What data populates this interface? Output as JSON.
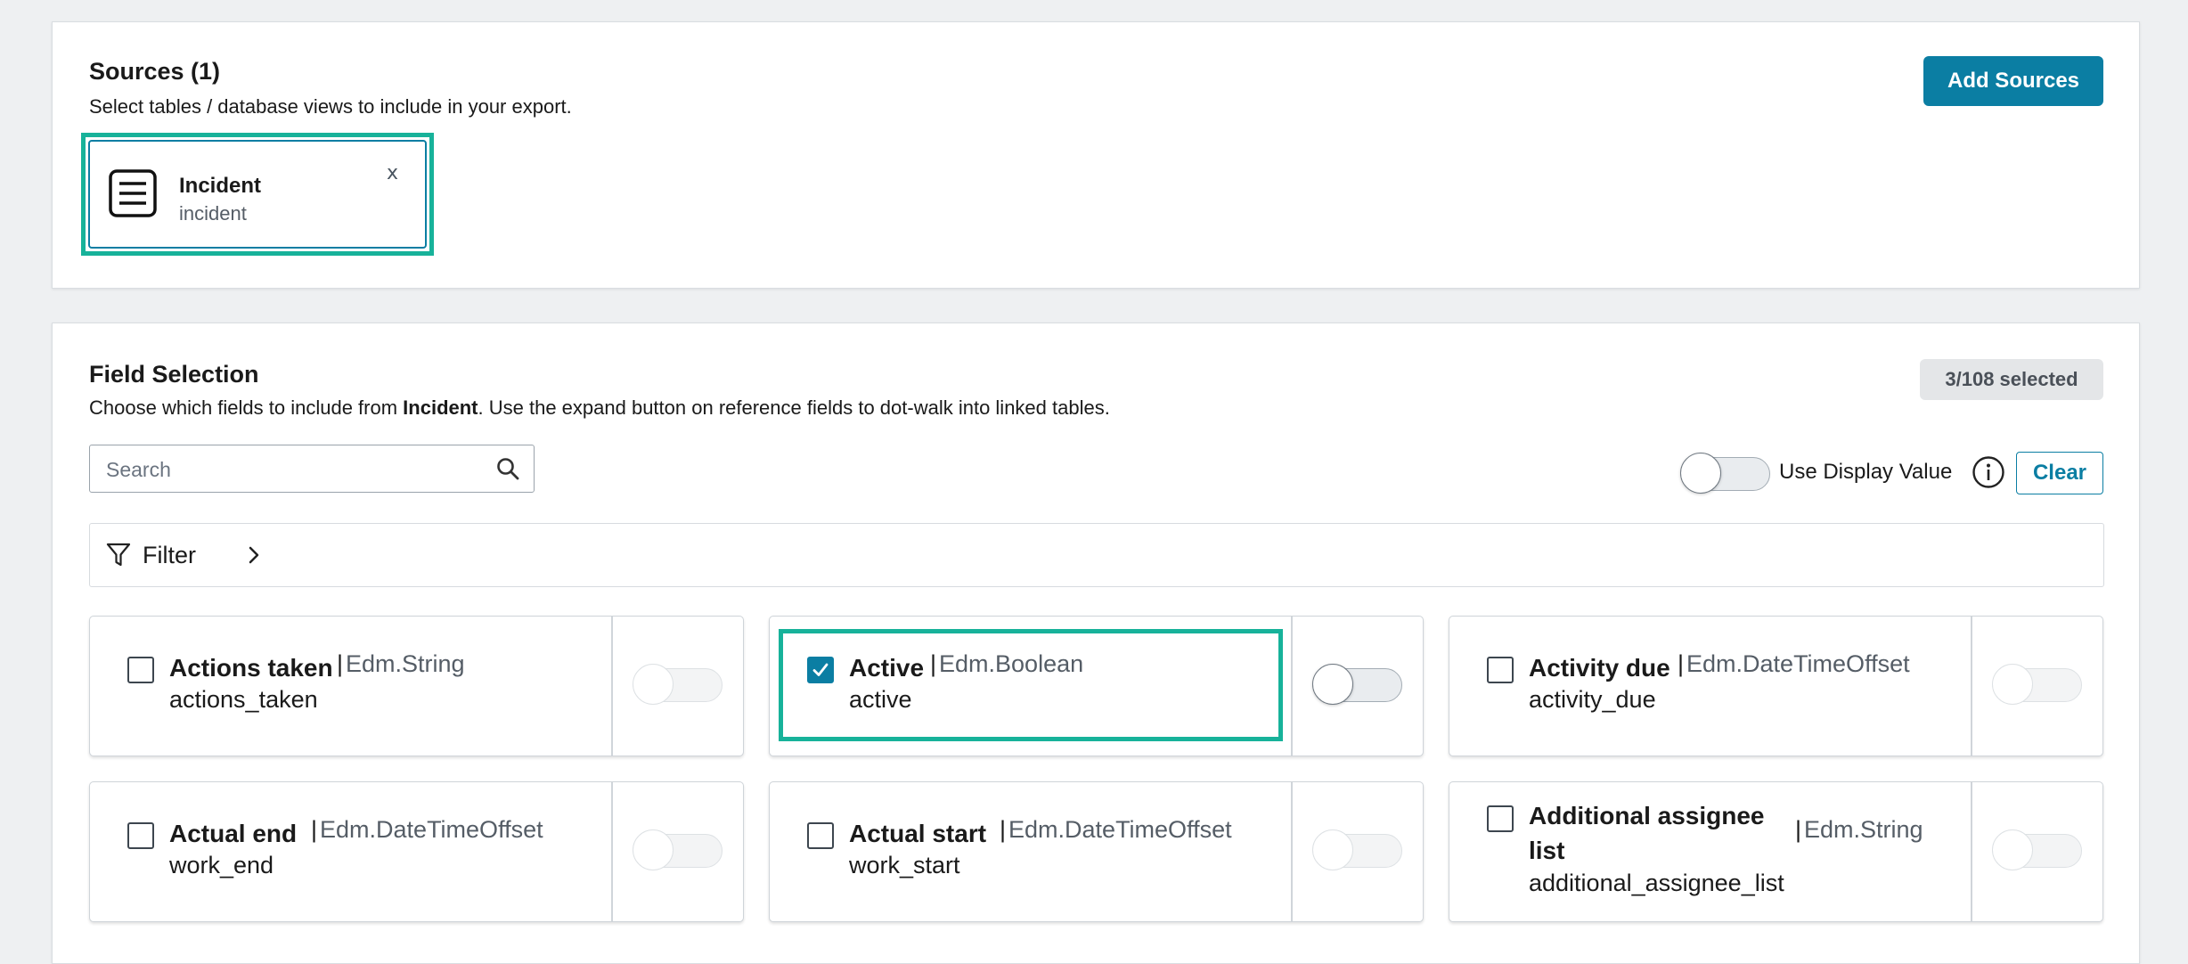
{
  "sources": {
    "title": "Sources (1)",
    "description": "Select tables / database views to include in your export.",
    "add_button": "Add Sources",
    "items": [
      {
        "label": "Incident",
        "name": "incident",
        "remove": "x"
      }
    ]
  },
  "fields": {
    "title": "Field Selection",
    "description_pre": "Choose which fields to include from ",
    "description_table": "Incident",
    "description_post": ". Use the expand button on reference fields to dot-walk into linked tables.",
    "selected_badge": "3/108 selected",
    "search_placeholder": "Search",
    "use_display_value_label": "Use Display Value",
    "clear_button": "Clear",
    "filter_label": "Filter",
    "type_separator": "|",
    "items": [
      {
        "label": "Actions taken",
        "type": "Edm.String",
        "name": "actions_taken",
        "checked": false
      },
      {
        "label": "Active",
        "type": "Edm.Boolean",
        "name": "active",
        "checked": true
      },
      {
        "label": "Activity due",
        "type": "Edm.DateTimeOffset",
        "name": "activity_due",
        "checked": false
      },
      {
        "label": "Actual end",
        "type": "Edm.DateTimeOffset",
        "name": "work_end",
        "checked": false
      },
      {
        "label": "Actual start",
        "type": "Edm.DateTimeOffset",
        "name": "work_start",
        "checked": false
      },
      {
        "label": "Additional assignee list",
        "type": "Edm.String",
        "name": "additional_assignee_list",
        "checked": false
      }
    ]
  },
  "colors": {
    "primary": "#0b7ea3",
    "highlight": "#17b29a"
  }
}
